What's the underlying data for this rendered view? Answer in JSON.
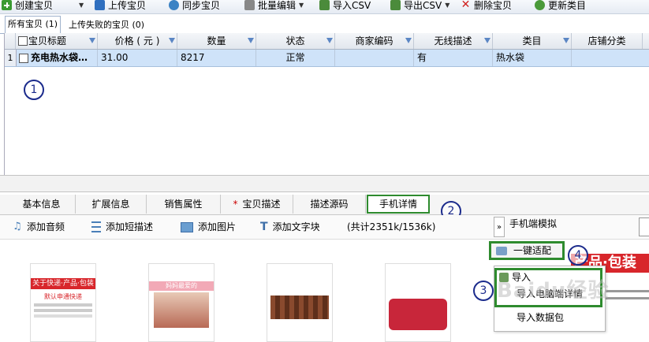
{
  "toolbar": {
    "create": "创建宝贝",
    "upload": "上传宝贝",
    "sync": "同步宝贝",
    "batch_edit": "批量编辑",
    "import_csv": "导入CSV",
    "export_csv": "导出CSV",
    "delete": "删除宝贝",
    "update_category": "更新类目"
  },
  "list_tabs": [
    "所有宝贝 (1)",
    "上传失败的宝贝 (0)"
  ],
  "grid": {
    "headers": [
      "宝贝标题",
      "价格 ( 元 )",
      "数量",
      "状态",
      "商家编码",
      "无线描述",
      "类目",
      "店铺分类"
    ],
    "rows": [
      {
        "num": "1",
        "title": "充电热水袋…",
        "price": "31.00",
        "qty": "8217",
        "status": "正常",
        "code": "",
        "wireless": "有",
        "category": "热水袋",
        "shop_cat": ""
      }
    ]
  },
  "annotations": {
    "one": "1",
    "two": "2",
    "three": "3",
    "four": "4"
  },
  "detail_tabs": [
    "基本信息",
    "扩展信息",
    "销售属性",
    "宝贝描述",
    "描述源码",
    "手机详情"
  ],
  "required_mark": "*",
  "mobile_toolbar": {
    "add_audio": "添加音频",
    "add_short_desc": "添加短描述",
    "add_image": "添加图片",
    "add_text": "添加文字块",
    "total": "(共计2351k/1536k)",
    "expand": "»",
    "mobile_preview": "手机端模拟"
  },
  "one_click": "一键适配",
  "menu": {
    "import": "导入",
    "import_pc": "导入电脑端详情",
    "import_pkg": "导入数据包"
  },
  "thumb1": {
    "title": "关于快递·产品·包装",
    "sub": "默认申通快递"
  },
  "thumb2": {
    "title": "妈妈最爱的"
  },
  "banner": {
    "title": "产品·包装"
  },
  "watermark": "Baidu经验",
  "colors": {
    "green_highlight": "#2e8b2e",
    "selected_row": "#cfe3f9",
    "annotation": "#1b2b8c"
  }
}
